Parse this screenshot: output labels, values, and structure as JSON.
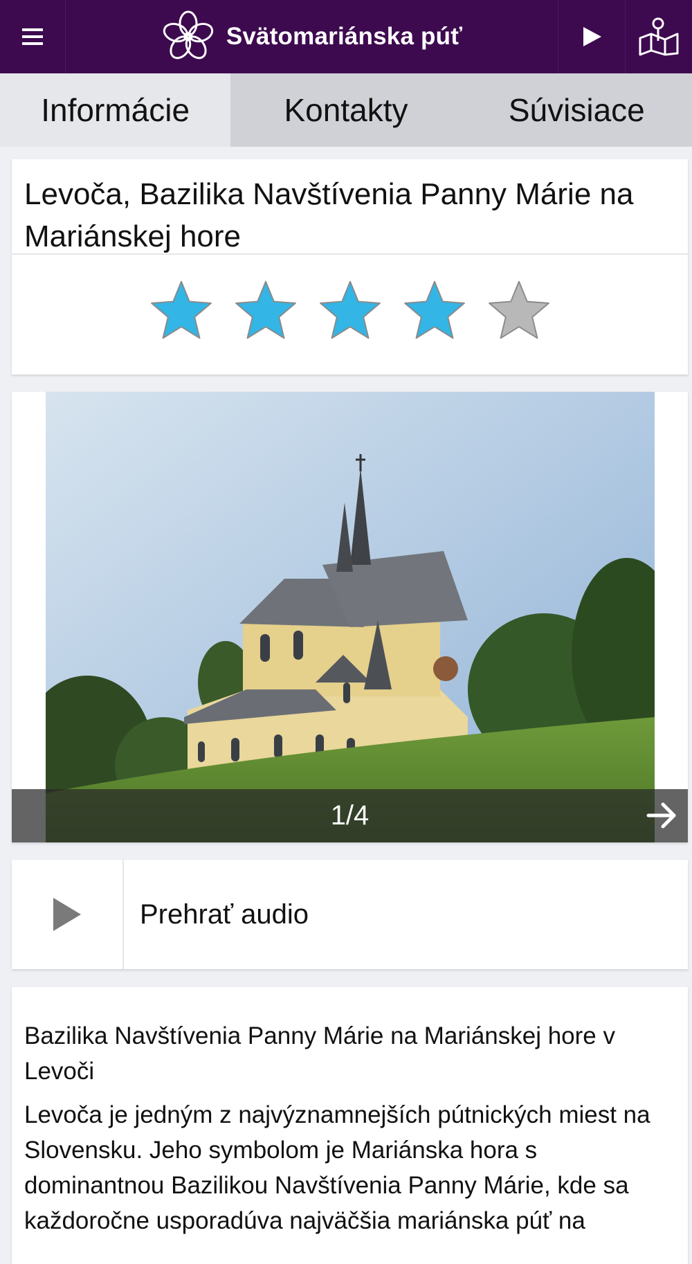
{
  "header": {
    "menu_icon": "hamburger-menu-icon",
    "logo_icon": "flower-logo-icon",
    "app_title": "Svätomariánska púť",
    "play_icon": "play-icon",
    "map_icon": "map-pin-icon"
  },
  "tabs": [
    {
      "label": "Informácie",
      "active": true
    },
    {
      "label": "Kontakty",
      "active": false
    },
    {
      "label": "Súvisiace",
      "active": false
    }
  ],
  "place": {
    "title": "Levoča, Bazilika Navštívenia Panny Márie na Mariánskej hore",
    "rating": 4,
    "rating_max": 5,
    "star_color_filled": "#33b5e5",
    "star_color_empty": "#b8b8b8"
  },
  "gallery": {
    "counter": "1/4",
    "next_icon": "arrow-right-icon"
  },
  "audio": {
    "play_icon": "play-triangle-icon",
    "label": "Prehrať audio"
  },
  "description": {
    "heading": "Bazilika Navštívenia Panny Márie na Mariánskej hore v Levoči",
    "body": "Levoča je jedným z najvýznamnejších pútnických miest na Slovensku. Jeho symbolom je Mariánska hora s dominantnou Bazilikou Navštívenia Panny Márie, kde sa každoročne usporadúva najväčšia mariánska púť na"
  },
  "colors": {
    "header_bg": "#3d0a4f",
    "tab_active_bg": "#e6e7ea",
    "tab_bg": "#cfd1d6"
  }
}
